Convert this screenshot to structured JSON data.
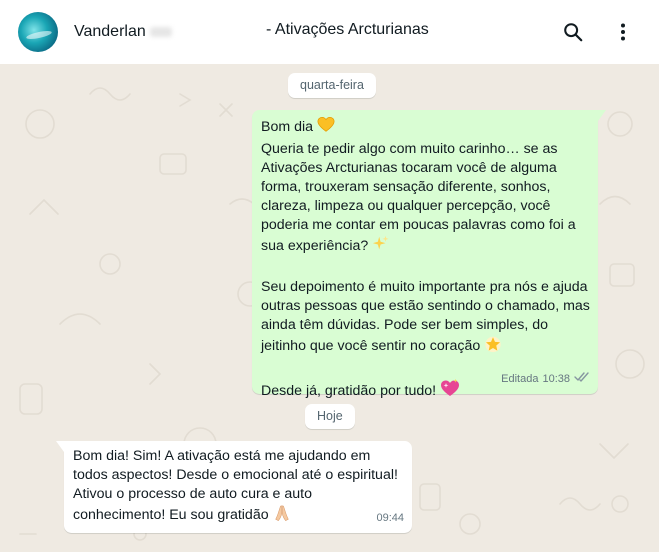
{
  "header": {
    "contact_name": "Vanderlan",
    "chat_title": "- Ativações Arcturianas",
    "search_icon": "search-icon",
    "menu_icon": "more-vertical-icon"
  },
  "chat": {
    "date_chips": [
      "quarta-feira",
      "Hoje"
    ],
    "messages": [
      {
        "direction": "outgoing",
        "lines": [
          "Bom dia",
          "Queria te pedir algo com muito carinho… se as",
          "Ativações Arcturianas tocaram você de alguma",
          "forma, trouxeram sensação diferente, sonhos,",
          "clareza, limpeza ou qualquer percepção, você",
          "poderia me contar em poucas palavras como foi a",
          "sua experiência?",
          "",
          "Seu depoimento é muito importante pra nós e ajuda",
          "outras pessoas que estão sentindo o chamado, mas",
          "ainda têm dúvidas. Pode ser bem simples, do",
          "jeitinho que você sentir no coração",
          "",
          "Desde já, gratidão por tudo!"
        ],
        "emojis": [
          "yellow-heart",
          "sparkles",
          "glowing-star",
          "sparkling-heart"
        ],
        "edited_label": "Editada",
        "time": "10:38",
        "status": "read"
      },
      {
        "direction": "incoming",
        "lines": [
          "Bom dia! Sim! A ativação está me ajudando em",
          "todos aspectos! Desde o emocional até o espiritual!",
          "Ativou o processo de auto cura e auto",
          "conhecimento! Eu sou gratidão"
        ],
        "emojis": [
          "folded-hands"
        ],
        "time": "09:44"
      }
    ]
  },
  "colors": {
    "outgoing_bubble": "#d9fdd3",
    "incoming_bubble": "#ffffff",
    "chat_background": "#efeae2",
    "read_ticks": "#8696a0"
  }
}
